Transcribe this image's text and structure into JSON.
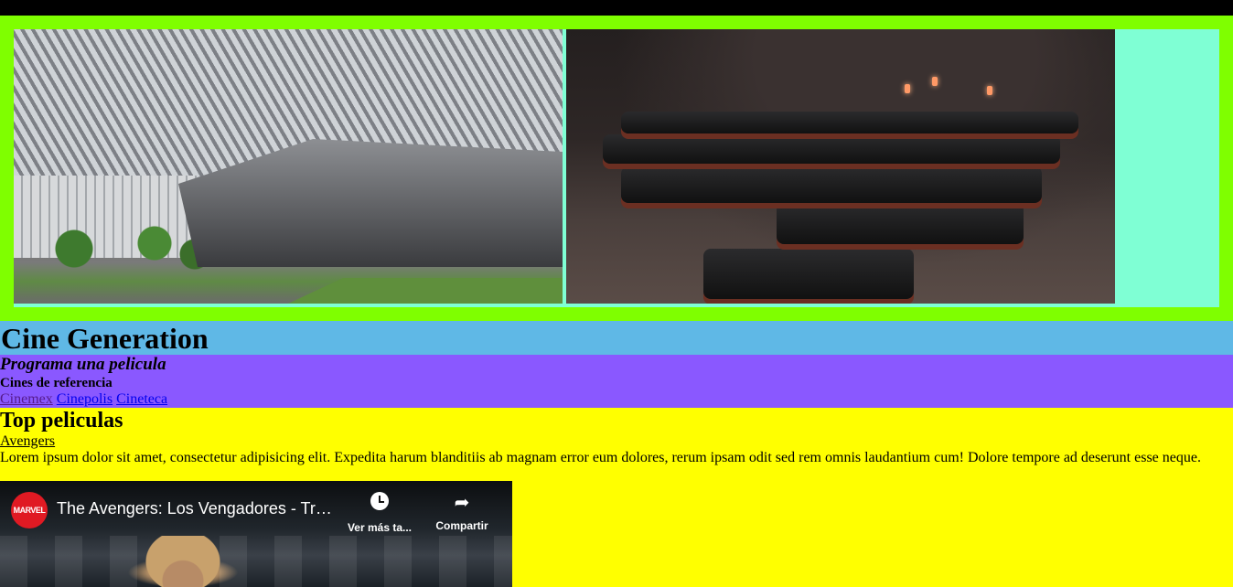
{
  "hero": {
    "images": [
      {
        "alt": "Edificio de la Cineteca"
      },
      {
        "alt": "Sala de cine con butacas"
      }
    ]
  },
  "header": {
    "title": "Cine Generation"
  },
  "section_program": {
    "heading": "Programa una pelicula",
    "subheading": "Cines de referencia",
    "links": [
      "Cinemex",
      "Cinepolis",
      "Cineteca"
    ]
  },
  "section_top": {
    "heading": "Top peliculas",
    "film_link": "Avengers",
    "description": "Lorem ipsum dolor sit amet, consectetur adipisicing elit. Expedita harum blanditiis ab magnam error eum dolores, rerum ipsam odit sed rem omnis laudantium cum! Dolore tempore ad deserunt esse neque."
  },
  "video": {
    "channel_badge": "MARVEL",
    "title": "The Avengers: Los Vengadores - Tráiler",
    "watch_later_label": "Ver más ta...",
    "share_label": "Compartir"
  },
  "colors": {
    "hero_frame": "#7fff00",
    "hero_bg": "#7fffd4",
    "title_band": "#5fb8e6",
    "purple_band": "#8a58ff",
    "yellow_band": "#ffff00"
  }
}
